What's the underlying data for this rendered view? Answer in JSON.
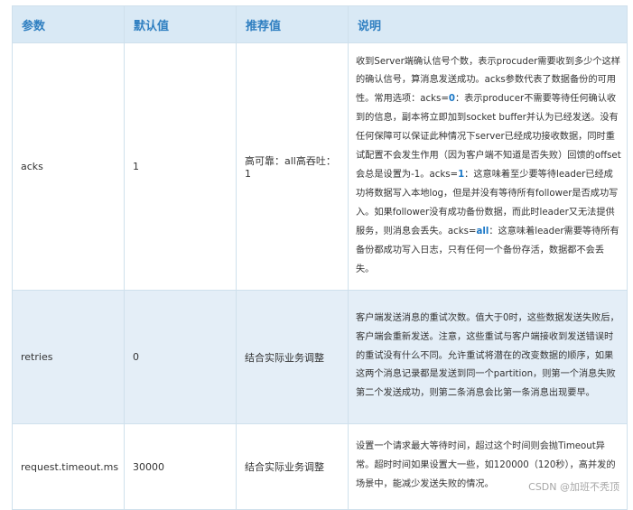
{
  "table": {
    "headers": [
      "参数",
      "默认值",
      "推荐值",
      "说明"
    ],
    "rows": [
      {
        "param": "acks",
        "default": "1",
        "recommended": "高可靠：all高吞吐：1",
        "description": {
          "part1": "收到Server端确认信号个数，表示procuder需要收到多少个这样的确认信号，算消息发送成功。acks参数代表了数据备份的可用性。常用选项：acks=",
          "v1": "0",
          "part2": "：表示producer不需要等待任何确认收到的信息，副本将立即加到socket buffer并认为已经发送。没有任何保障可以保证此种情况下server已经成功接收数据，同时重试配置不会发生作用（因为客户端不知道是否失败）回馈的offset会总是设置为-1。acks=",
          "v2": "1",
          "part3": "：这意味着至少要等待leader已经成功将数据写入本地log，但是并没有等待所有follower是否成功写入。如果follower没有成功备份数据，而此时leader又无法提供服务，则消息会丢失。acks=",
          "v3": "all",
          "part4": "：这意味着leader需要等待所有备份都成功写入日志，只有任何一个备份存活，数据都不会丢失。"
        }
      },
      {
        "param": "retries",
        "default": "0",
        "recommended": "结合实际业务调整",
        "description": "客户端发送消息的重试次数。值大于0时，这些数据发送失败后，客户端会重新发送。注意，这些重试与客户端接收到发送错误时的重试没有什么不同。允许重试将潜在的改变数据的顺序，如果这两个消息记录都是发送到同一个partition，则第一个消息失败第二个发送成功，则第二条消息会比第一条消息出现要早。"
      },
      {
        "param": "request.timeout.ms",
        "default": "30000",
        "recommended": "结合实际业务调整",
        "description": "设置一个请求最大等待时间，超过这个时间则会抛Timeout异常。超时时间如果设置大一些，如120000（120秒），高并发的场景中，能减少发送失败的情况。"
      }
    ]
  },
  "watermark": "CSDN @加班不秃顶"
}
